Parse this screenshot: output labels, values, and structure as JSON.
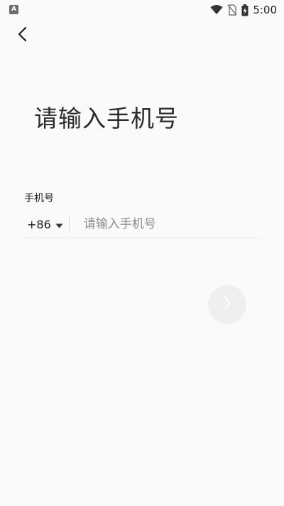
{
  "status_bar": {
    "app_icon_letter": "A",
    "time": "5:00",
    "icons": [
      "wifi-icon",
      "no-sim-icon",
      "battery-charging-icon"
    ]
  },
  "header": {
    "back_icon": "chevron-left-icon"
  },
  "main": {
    "title": "请输入手机号",
    "phone_field": {
      "label": "手机号",
      "country_code": "+86",
      "placeholder": "请输入手机号",
      "value": ""
    },
    "next_icon": "chevron-right-icon"
  },
  "colors": {
    "background": "#fafafa",
    "next_button_bg": "#efefef",
    "divider": "#e6e6e6"
  }
}
